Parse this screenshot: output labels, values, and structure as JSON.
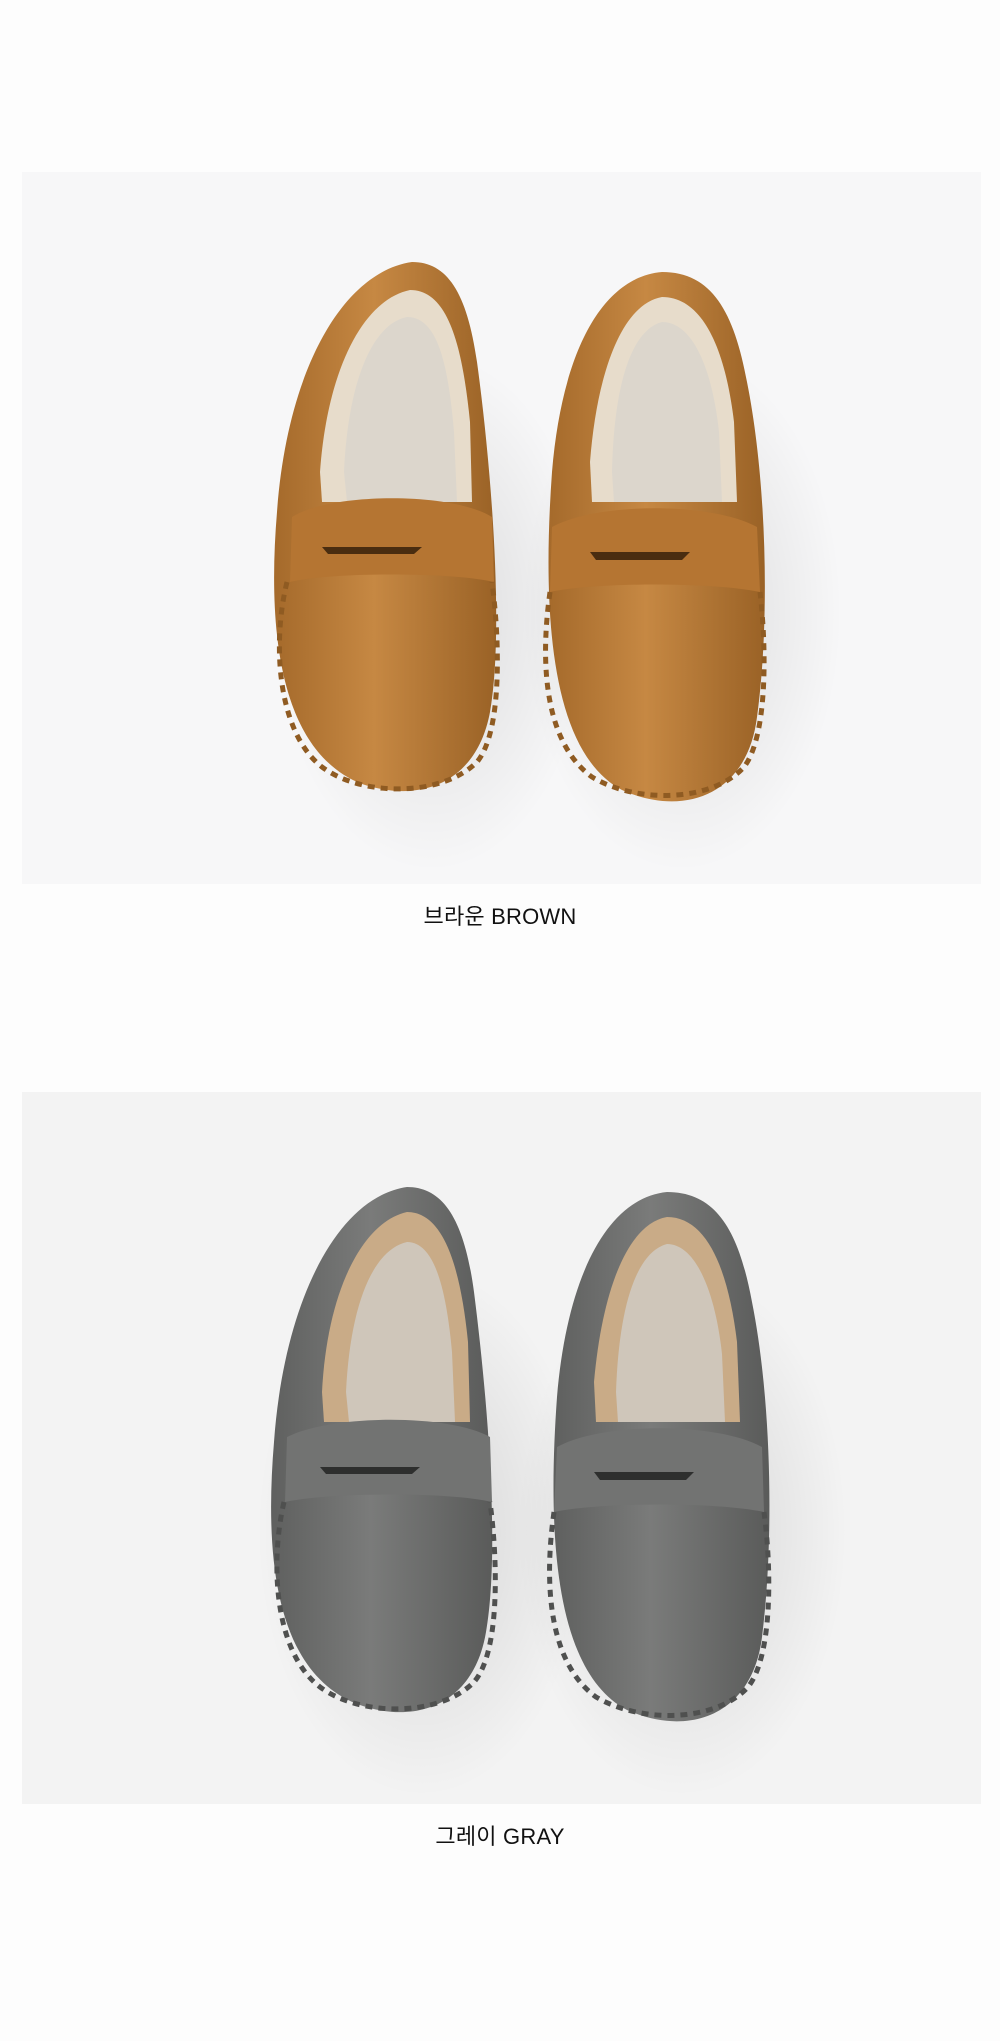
{
  "products": [
    {
      "caption": "브라운 BROWN",
      "color_name": "brown",
      "colors": {
        "leather": "#b97a36",
        "leather_dark": "#8f5b22",
        "leather_light": "#d39a58",
        "insole": "#dcd6cc",
        "lining": "#e7dccb",
        "backdrop": "#f7f7f8"
      }
    },
    {
      "caption": "그레이 GRAY",
      "color_name": "gray",
      "colors": {
        "leather": "#6e6f6e",
        "leather_dark": "#4f504f",
        "leather_light": "#8a8b8a",
        "insole": "#cfc6ba",
        "lining": "#c9ab87",
        "backdrop": "#f3f3f3"
      }
    }
  ]
}
